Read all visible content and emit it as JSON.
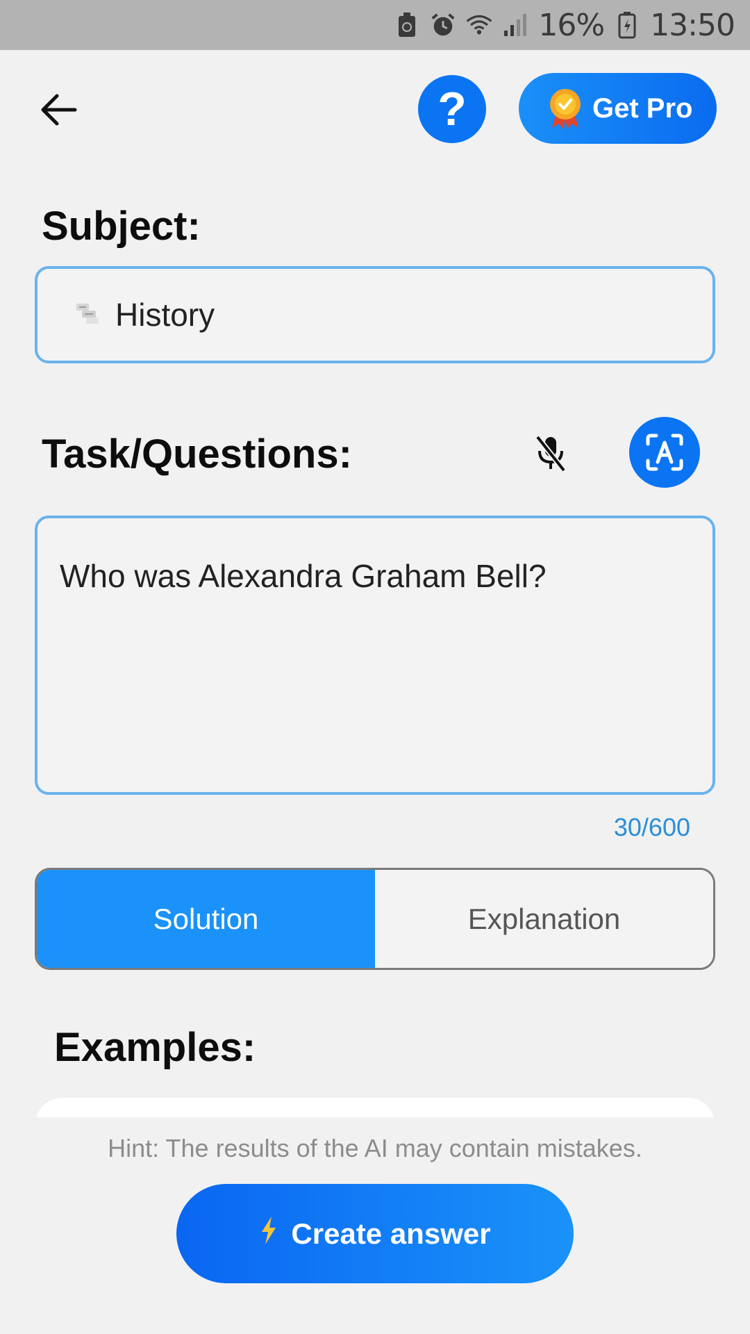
{
  "status_bar": {
    "battery_percent": "16%",
    "time": "13:50",
    "icons": [
      "battery-saver-icon",
      "alarm-icon",
      "wifi-icon",
      "signal-icon",
      "battery-icon"
    ]
  },
  "header": {
    "back_icon": "arrow-left-icon",
    "help_label": "?",
    "pro_label": "Get Pro",
    "pro_icon": "medal-icon"
  },
  "subject": {
    "label": "Subject:",
    "value": "History",
    "icon": "history-scroll-icon"
  },
  "task": {
    "label": "Task/Questions:",
    "text": "Who was Alexandra Graham Bell?",
    "counter": "30/600",
    "mic_icon": "mic-off-icon",
    "scan_icon": "text-scan-icon"
  },
  "mode": {
    "options": [
      "Solution",
      "Explanation"
    ],
    "selected": "Solution"
  },
  "examples": {
    "label": "Examples:"
  },
  "footer": {
    "hint": "Hint: The results of the AI may contain mistakes.",
    "create_label": "Create answer",
    "create_icon": "lightning-icon"
  },
  "colors": {
    "accent": "#0a74f2",
    "accent_light": "#1a92f9",
    "border": "#6ab3ec",
    "counter": "#2a8ed8"
  }
}
